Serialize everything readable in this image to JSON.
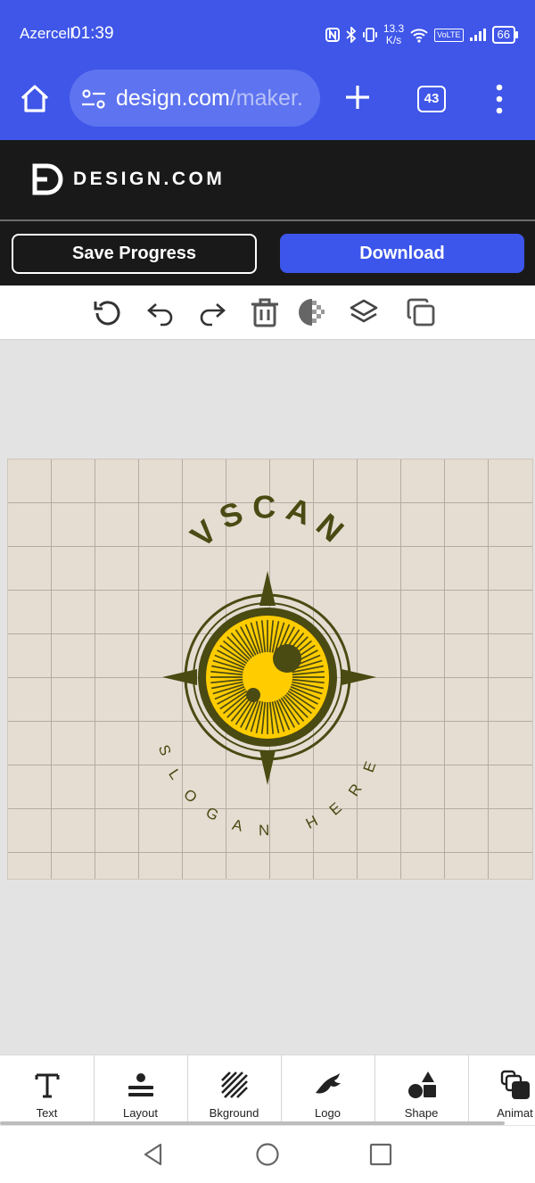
{
  "status_bar": {
    "carrier": "Azercell",
    "time": "01:39",
    "net_speed_value": "13.3",
    "net_speed_unit": "K/s",
    "volte": "VoLTE",
    "battery": "66"
  },
  "browser": {
    "url_host": "design.com",
    "url_path": "/maker.",
    "tab_count": "43"
  },
  "site": {
    "logo_text": "DESIGN.COM",
    "save_label": "Save Progress",
    "download_label": "Download"
  },
  "toolbar_icons": [
    "reset-icon",
    "undo-icon",
    "redo-icon",
    "delete-icon",
    "transparency-icon",
    "layers-icon",
    "duplicate-icon"
  ],
  "logo": {
    "name": "VSCAN",
    "slogan": "SLOGAN HERE",
    "colors": {
      "primary": "#4a4a13",
      "accent": "#ffcc00",
      "background": "#e5ddd2"
    }
  },
  "bottom_tools": [
    {
      "label": "Text",
      "icon": "text-icon"
    },
    {
      "label": "Layout",
      "icon": "layout-icon"
    },
    {
      "label": "Bkground",
      "icon": "background-icon"
    },
    {
      "label": "Logo",
      "icon": "logo-icon"
    },
    {
      "label": "Shape",
      "icon": "shape-icon"
    },
    {
      "label": "Animat",
      "icon": "animate-icon"
    }
  ],
  "colors": {
    "browser_bar": "#3f56e8",
    "site_header": "#191919",
    "download_button": "#3c55ea"
  }
}
